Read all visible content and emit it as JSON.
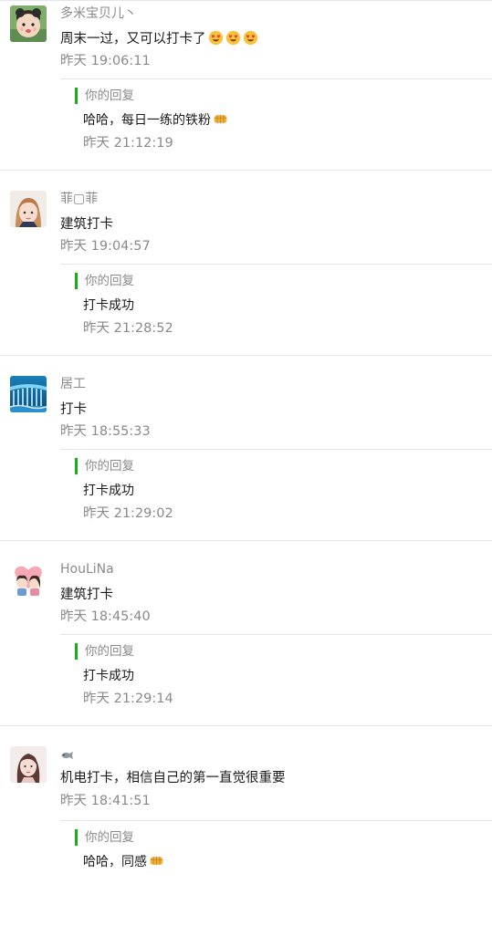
{
  "comments": [
    {
      "username": "多米宝贝儿丶",
      "content": "周末一过，又可以打卡了",
      "content_emojis": [
        "heart-eyes-icon",
        "heart-eyes-icon",
        "heart-eyes-icon"
      ],
      "time": "昨天 19:06:11",
      "reply_label": "你的回复",
      "reply_content": "哈哈，每日一练的铁粉",
      "reply_emoji": "fist-bump-icon",
      "reply_time": "昨天 21:12:19"
    },
    {
      "username": "菲▢菲",
      "content": "建筑打卡",
      "time": "昨天 19:04:57",
      "reply_label": "你的回复",
      "reply_content": "打卡成功",
      "reply_time": "昨天 21:28:52"
    },
    {
      "username": "居工",
      "content": "打卡",
      "time": "昨天 18:55:33",
      "reply_label": "你的回复",
      "reply_content": "打卡成功",
      "reply_time": "昨天 21:29:02"
    },
    {
      "username": "HouLiNa",
      "content": "建筑打卡",
      "time": "昨天 18:45:40",
      "reply_label": "你的回复",
      "reply_content": "打卡成功",
      "reply_time": "昨天 21:29:14"
    },
    {
      "username_icon": "fish-icon",
      "content": "机电打卡，相信自己的第一直觉很重要",
      "time": "昨天 18:41:51",
      "reply_label": "你的回复",
      "reply_content": "哈哈，同感",
      "reply_emoji": "fist-bump-icon"
    }
  ],
  "colors": {
    "accent": "#1aad19",
    "meta_text": "#8a8a8a",
    "divider": "#e6e6e6"
  }
}
